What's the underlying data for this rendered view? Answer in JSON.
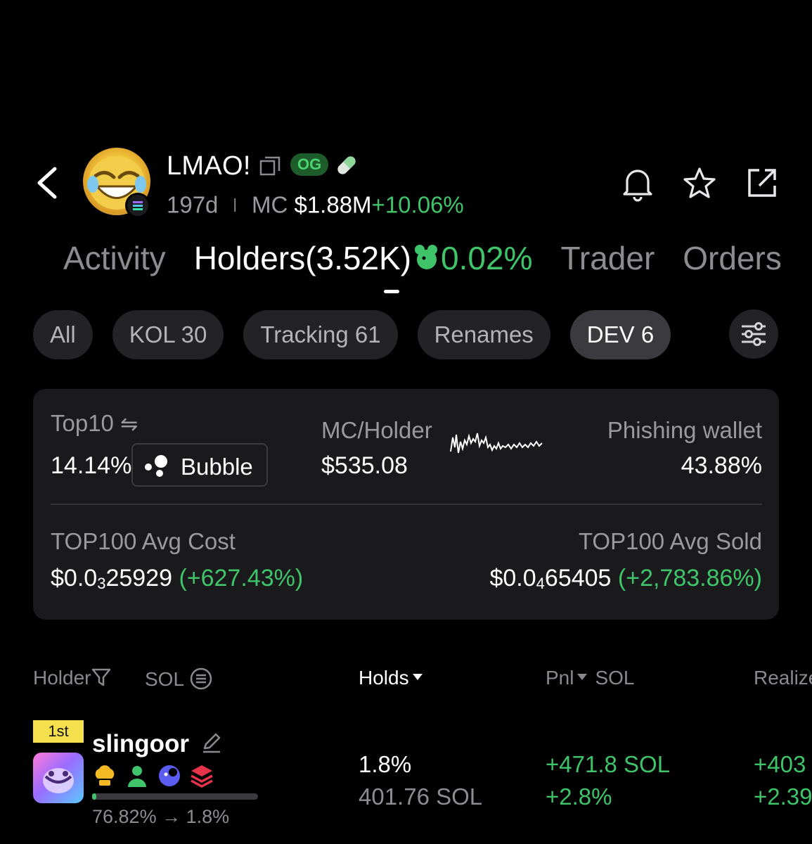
{
  "token": {
    "name": "LMAO!",
    "og_badge": "OG",
    "age": "197d",
    "mc_label": "MC",
    "mc_value": "$1.88M",
    "mc_change": "+10.06%"
  },
  "tabs": [
    {
      "label": "Activity",
      "active": false
    },
    {
      "label": "Holders(3.52K)",
      "active": true,
      "extra": "0.02%"
    },
    {
      "label": "Trader",
      "active": false
    },
    {
      "label": "Orders",
      "active": false
    }
  ],
  "chips": [
    {
      "label": "All",
      "active": false
    },
    {
      "label": "KOL 30",
      "active": false
    },
    {
      "label": "Tracking 61",
      "active": false
    },
    {
      "label": "Renames",
      "active": false
    },
    {
      "label": "DEV 6",
      "active": true
    }
  ],
  "stats": {
    "top10_label": "Top10",
    "top10_value": "14.14%",
    "bubble_label": "Bubble",
    "mc_holder_label": "MC/Holder",
    "mc_holder_value": "$535.08",
    "phishing_label": "Phishing wallet",
    "phishing_value": "43.88%",
    "avg_cost_label": "TOP100 Avg Cost",
    "avg_cost_prefix": "$0.0",
    "avg_cost_zeros": "3",
    "avg_cost_digits": "25929",
    "avg_cost_change": "(+627.43%)",
    "avg_sold_label": "TOP100 Avg Sold",
    "avg_sold_prefix": "$0.0",
    "avg_sold_zeros": "4",
    "avg_sold_digits": "65405",
    "avg_sold_change": "(+2,783.86%)"
  },
  "table": {
    "headers": {
      "holder": "Holder",
      "sol": "SOL",
      "holds": "Holds",
      "pnl": "Pnl",
      "pnl_unit": "SOL",
      "realized": "Realized"
    }
  },
  "holders": [
    {
      "rank": "1st",
      "name": "slingoor",
      "holding_fraction": 0.018,
      "range": "76.82% → 1.8%",
      "holds_pct": "1.8%",
      "holds_sol": "401.76 SOL",
      "pnl_sol": "+471.8 SOL",
      "pnl_pct": "+2.8%",
      "realized_sol": "+403",
      "realized_pct": "+2.39"
    }
  ],
  "colors": {
    "accent_green": "#3fc46a",
    "background": "#000000",
    "card": "#1a1a1c",
    "chip": "#232326",
    "rank_badge": "#f4e04d"
  },
  "icons": [
    "back-arrow-icon",
    "copy-icon",
    "pill-icon",
    "bell-icon",
    "star-icon",
    "share-icon",
    "mouse-icon",
    "filter-sliders-icon",
    "swap-icon",
    "bubble-icon",
    "funnel-icon",
    "sort-caret-icon",
    "edit-icon"
  ]
}
